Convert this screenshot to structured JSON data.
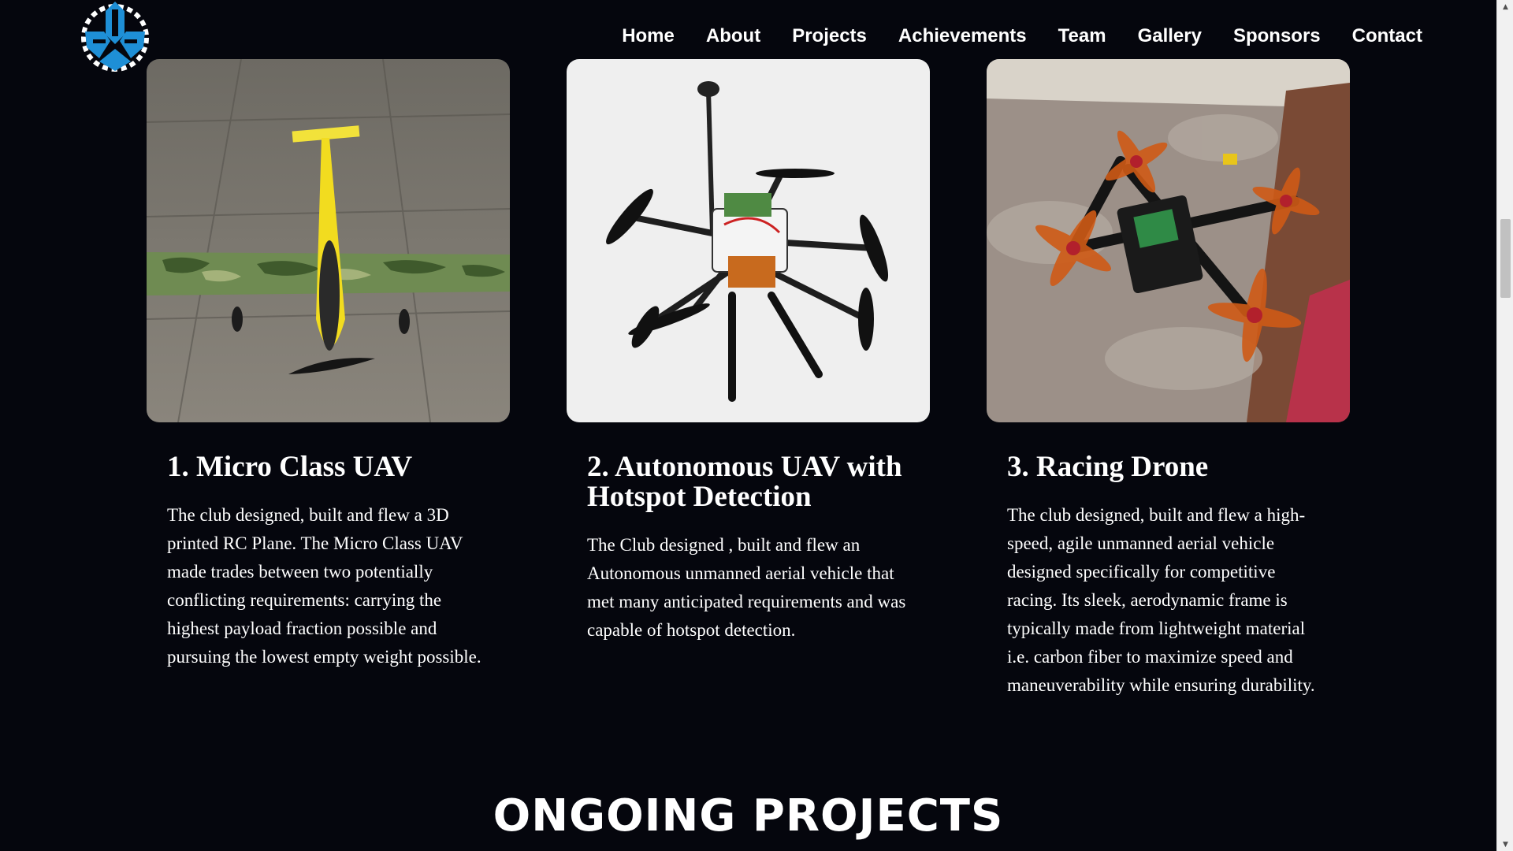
{
  "nav": {
    "items": [
      {
        "label": "Home"
      },
      {
        "label": "About"
      },
      {
        "label": "Projects"
      },
      {
        "label": "Achievements"
      },
      {
        "label": "Team"
      },
      {
        "label": "Gallery"
      },
      {
        "label": "Sponsors"
      },
      {
        "label": "Contact"
      }
    ]
  },
  "projects": [
    {
      "title": "1. Micro Class UAV",
      "description": "The club designed, built and flew a 3D printed RC Plane. The Micro Class UAV made trades between two potentially conflicting requirements: carrying the highest payload fraction possible and pursuing the lowest empty weight possible."
    },
    {
      "title": "2. Autonomous UAV with Hotspot Detection",
      "description": "The Club designed , built and flew an Autonomous unmanned aerial vehicle that met many anticipated requirements and was capable of hotspot detection."
    },
    {
      "title": "3. Racing Drone",
      "description": "The club designed, built and flew a high-speed, agile unmanned aerial vehicle designed specifically for competitive racing. Its sleek, aerodynamic frame is typically made from lightweight material i.e. carbon fiber to maximize speed and maneuverability while ensuring durability."
    }
  ],
  "sections": {
    "ongoing_heading": "ONGOING PROJECTS"
  },
  "colors": {
    "background": "#05060d",
    "logo_blue": "#1e8fd6",
    "text": "#ffffff"
  },
  "icons": {
    "logo": "club-gear-logo-icon"
  }
}
